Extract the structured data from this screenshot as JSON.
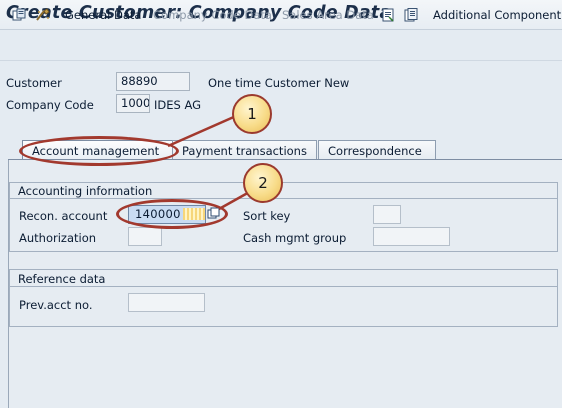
{
  "window": {
    "title": "Create Customer: Company Code Data"
  },
  "toolbar": {
    "general_data": "General Data",
    "company_code_data": "Company Code Data",
    "sales_area_data": "Sales Area Data",
    "additional_component": "Additional Component"
  },
  "header": {
    "customer_label": "Customer",
    "customer_value": "88890",
    "customer_description": "One time Customer New",
    "company_code_label": "Company Code",
    "company_code_value": "1000",
    "company_code_description": "IDES AG"
  },
  "tabs": [
    {
      "label": "Account management",
      "active": true
    },
    {
      "label": "Payment transactions",
      "active": false
    },
    {
      "label": "Correspondence",
      "active": false
    }
  ],
  "accounting": {
    "title": "Accounting information",
    "recon_label": "Recon. account",
    "recon_value": "140000",
    "sort_key_label": "Sort key",
    "sort_key_value": "",
    "authorization_label": "Authorization",
    "authorization_value": "",
    "cash_mgmt_label": "Cash mgmt group",
    "cash_mgmt_value": ""
  },
  "reference": {
    "title": "Reference data",
    "prev_acct_label": "Prev.acct no.",
    "prev_acct_value": ""
  },
  "annotations": {
    "step1": "1",
    "step2": "2"
  },
  "colors": {
    "annotation_red": "#a2392e",
    "annotation_fill": "#f8dc8a",
    "background": "#e4ebf2",
    "highlight_field": "#c9dcf3"
  }
}
